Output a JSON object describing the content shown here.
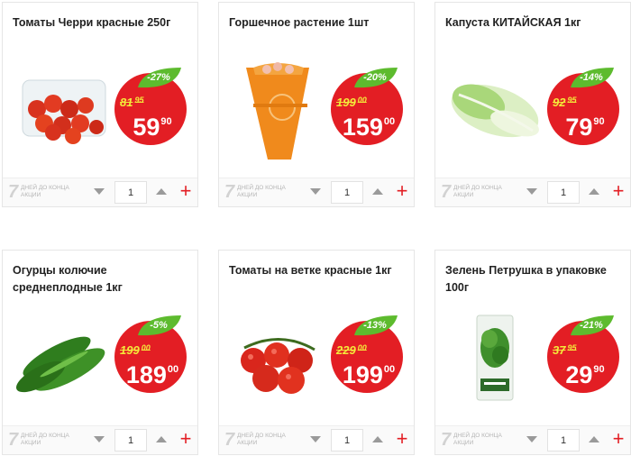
{
  "products": [
    {
      "title": "Томаты Черри красные 250г",
      "discount": "-27%",
      "old_rub": "81",
      "old_kop": "95",
      "new_rub": "59",
      "new_kop": "90",
      "days": "7",
      "days_label": "ДНЕЙ ДО КОНЦА АКЦИИ",
      "qty": "1",
      "image": "cherry-tomatoes-image"
    },
    {
      "title": "Горшечное растение 1шт",
      "discount": "-20%",
      "old_rub": "199",
      "old_kop": "00",
      "new_rub": "159",
      "new_kop": "00",
      "days": "7",
      "days_label": "ДНЕЙ ДО КОНЦА АКЦИИ",
      "qty": "1",
      "image": "potted-plant-image"
    },
    {
      "title": "Капуста КИТАЙСКАЯ 1кг",
      "discount": "-14%",
      "old_rub": "92",
      "old_kop": "95",
      "new_rub": "79",
      "new_kop": "90",
      "days": "7",
      "days_label": "ДНЕЙ ДО КОНЦА АКЦИИ",
      "qty": "1",
      "image": "chinese-cabbage-image"
    },
    {
      "title": "Огурцы колючие среднеплодные 1кг",
      "discount": "-5%",
      "old_rub": "199",
      "old_kop": "00",
      "new_rub": "189",
      "new_kop": "00",
      "days": "7",
      "days_label": "ДНЕЙ ДО КОНЦА АКЦИИ",
      "qty": "1",
      "image": "cucumbers-image"
    },
    {
      "title": "Томаты на ветке красные 1кг",
      "discount": "-13%",
      "old_rub": "229",
      "old_kop": "00",
      "new_rub": "199",
      "new_kop": "00",
      "days": "7",
      "days_label": "ДНЕЙ ДО КОНЦА АКЦИИ",
      "qty": "1",
      "image": "vine-tomatoes-image"
    },
    {
      "title": "Зелень Петрушка в упаковке 100г",
      "discount": "-21%",
      "old_rub": "37",
      "old_kop": "95",
      "new_rub": "29",
      "new_kop": "90",
      "days": "7",
      "days_label": "ДНЕЙ ДО КОНЦА АКЦИИ",
      "qty": "1",
      "image": "parsley-pack-image"
    }
  ],
  "colors": {
    "badge": "#e31e24",
    "discount_leaf": "#5dbb2e",
    "old_price": "#f4ea3a",
    "add": "#e31e24"
  }
}
